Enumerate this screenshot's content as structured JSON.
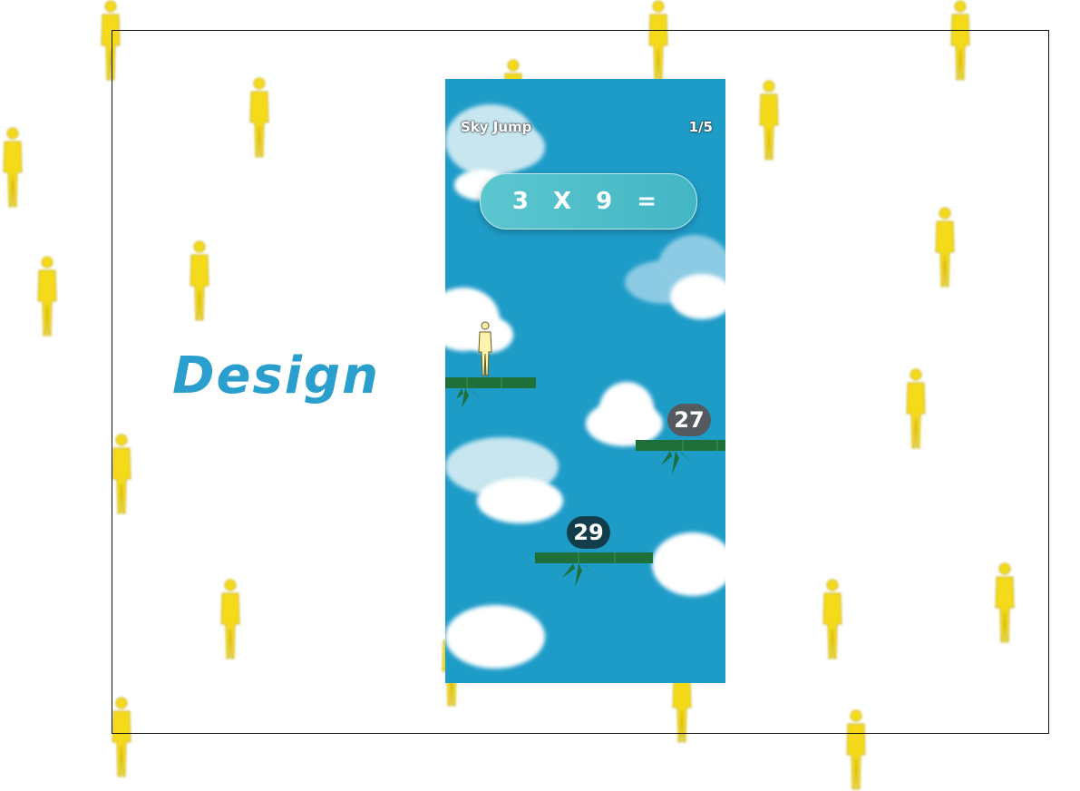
{
  "page": {
    "heading": "Design",
    "accent_color": "#2a9fce",
    "figure_color": "#f5d90d",
    "figure_icon": "person-figure-icon"
  },
  "game": {
    "title": "Sky Jump",
    "progress": "1/5",
    "question": "3 X 9 =",
    "sky_color": "#1e9cc8",
    "player_icon": "player-character-icon",
    "answers": [
      {
        "value": "27",
        "badge_color": "#555a5e"
      },
      {
        "value": "29",
        "badge_color": "#123d4a"
      }
    ],
    "platform_color": "#1e6f3a"
  }
}
